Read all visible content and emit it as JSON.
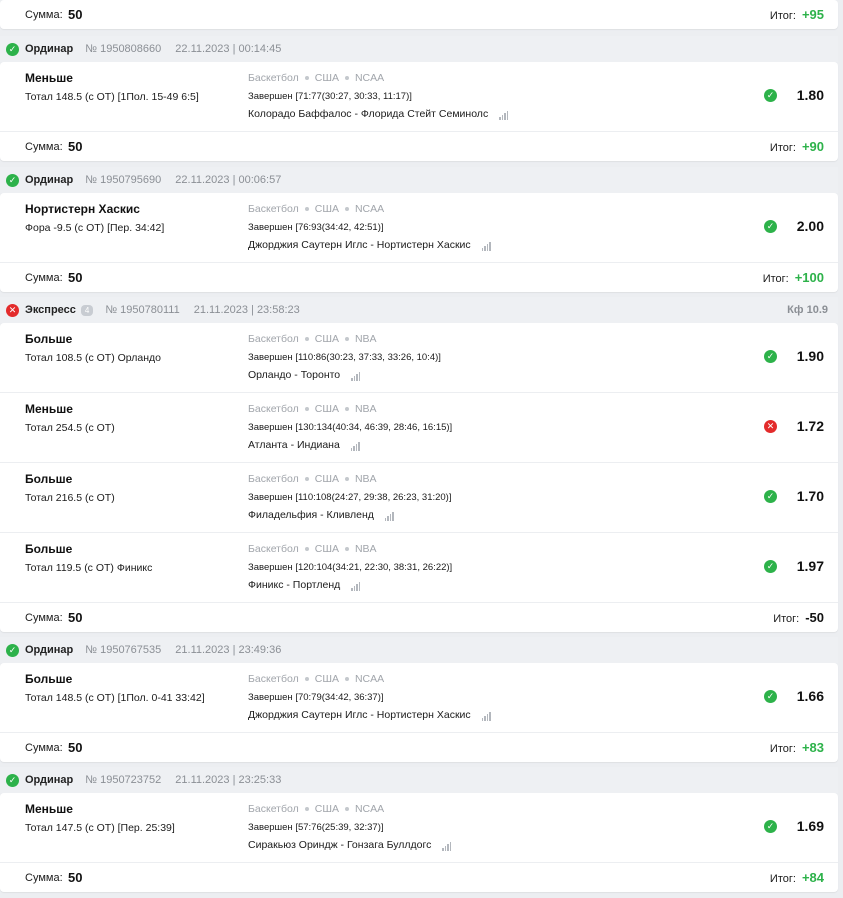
{
  "labels": {
    "sum": "Сумма:",
    "result": "Итог:",
    "coef_prefix": "Кф"
  },
  "colors": {
    "win": "#2db24a",
    "loss": "#e32b2b"
  },
  "top_footer": {
    "sum": "50",
    "result": "+95"
  },
  "bets": [
    {
      "status": "win",
      "type": "Ординар",
      "number": "№ 1950808660",
      "date": "22.11.2023 | 00:14:45",
      "events": [
        {
          "pick": "Меньше",
          "market": "Тотал 148.5 (с ОТ) [1Пол. 15-49 6:5]",
          "sport": "Баскетбол",
          "country": "США",
          "league": "NCAA",
          "score": "Завершен [71:77(30:27, 30:33, 11:17)]",
          "match": "Колорадо Баффалос - Флорида Стейт Семинолс",
          "status": "win",
          "odds": "1.80"
        }
      ],
      "sum": "50",
      "result": "+90"
    },
    {
      "status": "win",
      "type": "Ординар",
      "number": "№ 1950795690",
      "date": "22.11.2023 | 00:06:57",
      "events": [
        {
          "pick": "Нортистерн Хаскис",
          "market": "Фора -9.5 (с ОТ) [Пер. 34:42]",
          "sport": "Баскетбол",
          "country": "США",
          "league": "NCAA",
          "score": "Завершен [76:93(34:42, 42:51)]",
          "match": "Джорджия Саутерн Иглс - Нортистерн Хаскис",
          "status": "win",
          "odds": "2.00"
        }
      ],
      "sum": "50",
      "result": "+100"
    },
    {
      "status": "loss",
      "type": "Экспресс",
      "badge": "4",
      "number": "№ 1950780111",
      "date": "21.11.2023 | 23:58:23",
      "coef": "10.9",
      "events": [
        {
          "pick": "Больше",
          "market": "Тотал 108.5 (с ОТ) Орландо",
          "sport": "Баскетбол",
          "country": "США",
          "league": "NBA",
          "score": "Завершен [110:86(30:23, 37:33, 33:26, 10:4)]",
          "match": "Орландо - Торонто",
          "status": "win",
          "odds": "1.90"
        },
        {
          "pick": "Меньше",
          "market": "Тотал 254.5 (с ОТ)",
          "sport": "Баскетбол",
          "country": "США",
          "league": "NBA",
          "score": "Завершен [130:134(40:34, 46:39, 28:46, 16:15)]",
          "match": "Атланта - Индиана",
          "status": "loss",
          "odds": "1.72"
        },
        {
          "pick": "Больше",
          "market": "Тотал 216.5 (с ОТ)",
          "sport": "Баскетбол",
          "country": "США",
          "league": "NBA",
          "score": "Завершен [110:108(24:27, 29:38, 26:23, 31:20)]",
          "match": "Филадельфия - Кливленд",
          "status": "win",
          "odds": "1.70"
        },
        {
          "pick": "Больше",
          "market": "Тотал 119.5 (с ОТ) Финикс",
          "sport": "Баскетбол",
          "country": "США",
          "league": "NBA",
          "score": "Завершен [120:104(34:21, 22:30, 38:31, 26:22)]",
          "match": "Финикс - Портленд",
          "status": "win",
          "odds": "1.97"
        }
      ],
      "sum": "50",
      "result": "-50"
    },
    {
      "status": "win",
      "type": "Ординар",
      "number": "№ 1950767535",
      "date": "21.11.2023 | 23:49:36",
      "events": [
        {
          "pick": "Больше",
          "market": "Тотал 148.5 (с ОТ) [1Пол. 0-41 33:42]",
          "sport": "Баскетбол",
          "country": "США",
          "league": "NCAA",
          "score": "Завершен [70:79(34:42, 36:37)]",
          "match": "Джорджия Саутерн Иглс - Нортистерн Хаскис",
          "status": "win",
          "odds": "1.66"
        }
      ],
      "sum": "50",
      "result": "+83"
    },
    {
      "status": "win",
      "type": "Ординар",
      "number": "№ 1950723752",
      "date": "21.11.2023 | 23:25:33",
      "events": [
        {
          "pick": "Меньше",
          "market": "Тотал 147.5 (с ОТ) [Пер. 25:39]",
          "sport": "Баскетбол",
          "country": "США",
          "league": "NCAA",
          "score": "Завершен [57:76(25:39, 32:37)]",
          "match": "Сиракьюз Ориндж - Гонзага Буллдогс",
          "status": "win",
          "odds": "1.69"
        }
      ],
      "sum": "50",
      "result": "+84"
    }
  ]
}
